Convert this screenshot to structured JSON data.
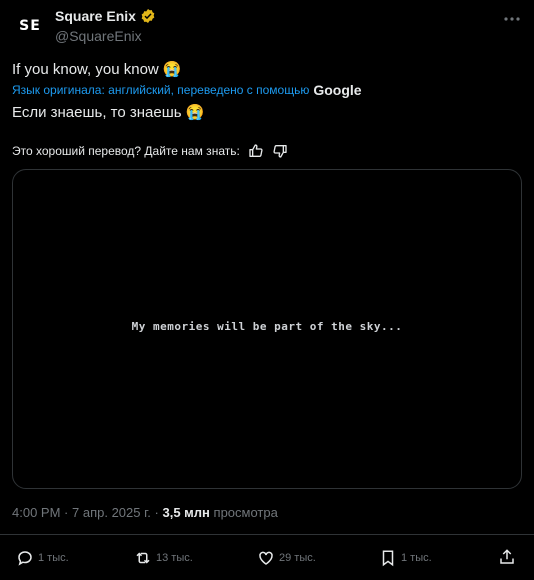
{
  "author": {
    "avatar_text": "SE",
    "display_name": "Square Enix",
    "handle": "@SquareEnix"
  },
  "tweet": {
    "text": "If you know, you know 😭",
    "translation_note": "Язык оригинала: английский, переведено с помощью",
    "translator": "Google",
    "translated_text": "Если знаешь, то знаешь 😭",
    "rate_prompt": "Это хороший перевод? Дайте нам знать:"
  },
  "media": {
    "caption": "My memories will be part of the sky..."
  },
  "meta": {
    "time": "4:00 PM",
    "date": "7 апр. 2025 г.",
    "separator": "·",
    "views_count": "3,5 млн",
    "views_label": "просмотра"
  },
  "actions": {
    "replies": "1 тыс.",
    "reposts": "13 тыс.",
    "likes": "29 тыс.",
    "bookmarks": "1 тыс."
  },
  "colors": {
    "background": "#000000",
    "link_blue": "#1d9bf0",
    "muted": "#71767b",
    "verified_gold": "#e2b719"
  }
}
